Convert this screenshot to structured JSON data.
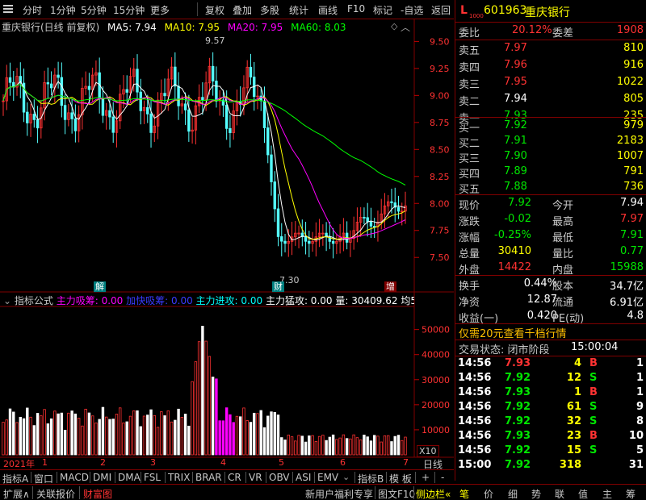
{
  "toolbar": {
    "items": [
      "分时",
      "1分钟",
      "5分钟",
      "15分钟",
      "更多",
      "复权",
      "叠加",
      "多股",
      "统计",
      "画线",
      "F10",
      "标记",
      "-自选",
      "返回"
    ]
  },
  "chart_data": {
    "type": "candlestick",
    "title": "重庆银行(日线 前复权)",
    "ma_legend": [
      {
        "label": "MA5: 7.94",
        "color": "#ffffff"
      },
      {
        "label": "MA10: 7.95",
        "color": "#ffff00"
      },
      {
        "label": "MA20: 7.95",
        "color": "#ff00ff"
      },
      {
        "label": "MA60: 8.03",
        "color": "#00ff00"
      }
    ],
    "price_axis": {
      "ticks": [
        "9.50",
        "9.25",
        "9.00",
        "8.75",
        "8.50",
        "8.25",
        "8.00",
        "7.75",
        "7.50"
      ],
      "min": 7.3,
      "max": 9.6
    },
    "annotations": {
      "high": "9.57",
      "low": "7.30"
    },
    "event_markers": [
      "解",
      "财",
      "增"
    ],
    "indicator": {
      "name": "指标公式",
      "fields": [
        {
          "label": "主力吸筹: 0.00",
          "color": "#ff00ff"
        },
        {
          "label": "加快吸筹: 0.00",
          "color": "#3a3aff"
        },
        {
          "label": "主力进攻: 0.00",
          "color": "#00ffff"
        },
        {
          "label": "主力猛攻: 0.00",
          "color": "#ffffff"
        },
        {
          "label": "量: 30409.62",
          "color": "#ffffff"
        },
        {
          "label": "均5: 3",
          "color": "#ffffff"
        }
      ],
      "axis_ticks": [
        "50000",
        "40000",
        "30000",
        "20000",
        "10000"
      ],
      "unit": "X10"
    },
    "x_axis": {
      "labels": [
        "2021年",
        "1",
        "2",
        "3",
        "4",
        "5",
        "6",
        "7"
      ],
      "period": "日线"
    }
  },
  "indicator_tabs": [
    "指标A",
    "窗口",
    "MACD",
    "DMI",
    "DMA",
    "FSL",
    "TRIX",
    "BRAR",
    "CR",
    "VR",
    "OBV",
    "ASI",
    "EMV",
    "指标B",
    "模 板",
    "+",
    "-"
  ],
  "quote": {
    "code": "601963",
    "name": "重庆银行",
    "badge": "L",
    "badge_sub": "1000",
    "weibi_label": "委比",
    "weibi": "20.12%",
    "weicha_label": "委差",
    "weicha": "1908",
    "asks": [
      {
        "label": "卖五",
        "price": "7.97",
        "vol": "810"
      },
      {
        "label": "卖四",
        "price": "7.96",
        "vol": "916"
      },
      {
        "label": "卖三",
        "price": "7.95",
        "vol": "1022"
      },
      {
        "label": "卖二",
        "price": "7.94",
        "vol": "805"
      },
      {
        "label": "卖一",
        "price": "7.93",
        "vol": "235"
      }
    ],
    "bids": [
      {
        "label": "买一",
        "price": "7.92",
        "vol": "979"
      },
      {
        "label": "买二",
        "price": "7.91",
        "vol": "2183"
      },
      {
        "label": "买三",
        "price": "7.90",
        "vol": "1007"
      },
      {
        "label": "买四",
        "price": "7.89",
        "vol": "791"
      },
      {
        "label": "买五",
        "price": "7.88",
        "vol": "736"
      }
    ],
    "stats": [
      {
        "l1": "现价",
        "v1": "7.92",
        "l2": "今开",
        "v2": "7.94"
      },
      {
        "l1": "涨跌",
        "v1": "-0.02",
        "l2": "最高",
        "v2": "7.97"
      },
      {
        "l1": "涨幅",
        "v1": "-0.25%",
        "l2": "最低",
        "v2": "7.91"
      },
      {
        "l1": "总量",
        "v1": "30410",
        "l2": "量比",
        "v2": "0.77"
      },
      {
        "l1": "外盘",
        "v1": "14422",
        "l2": "内盘",
        "v2": "15988"
      }
    ],
    "fin": [
      {
        "l1": "换手",
        "v1": "0.44%",
        "l2": "股本",
        "v2": "34.7亿"
      },
      {
        "l1": "净资",
        "v1": "12.87",
        "l2": "流通",
        "v2": "6.91亿"
      },
      {
        "l1": "收益(一)",
        "v1": "0.420",
        "l2": "PE(动)",
        "v2": "4.8"
      }
    ],
    "promo": "仅需20元查看千档行情",
    "trade_status_label": "交易状态: 闭市阶段",
    "trade_time": "15:00:04",
    "ticks": [
      {
        "time": "14:56",
        "price": "7.93",
        "vol": "4",
        "bs": "B",
        "n": "1"
      },
      {
        "time": "14:56",
        "price": "7.92",
        "vol": "12",
        "bs": "S",
        "n": "1"
      },
      {
        "time": "14:56",
        "price": "7.93",
        "vol": "1",
        "bs": "B",
        "n": "1"
      },
      {
        "time": "14:56",
        "price": "7.92",
        "vol": "61",
        "bs": "S",
        "n": "9"
      },
      {
        "time": "14:56",
        "price": "7.92",
        "vol": "32",
        "bs": "S",
        "n": "8"
      },
      {
        "time": "14:56",
        "price": "7.93",
        "vol": "23",
        "bs": "B",
        "n": "10"
      },
      {
        "time": "14:56",
        "price": "7.92",
        "vol": "15",
        "bs": "S",
        "n": "5"
      },
      {
        "time": "15:00",
        "price": "7.92",
        "vol": "318",
        "bs": "",
        "n": "31"
      }
    ]
  },
  "status_bar": {
    "left": [
      "扩展∧",
      "关联报价",
      "财富图"
    ],
    "center": [
      "新用户福利专享",
      "图文F10",
      "侧边栏«"
    ],
    "right": [
      "笔",
      "价",
      "细",
      "势",
      "联",
      "值",
      "主",
      "筹"
    ]
  }
}
